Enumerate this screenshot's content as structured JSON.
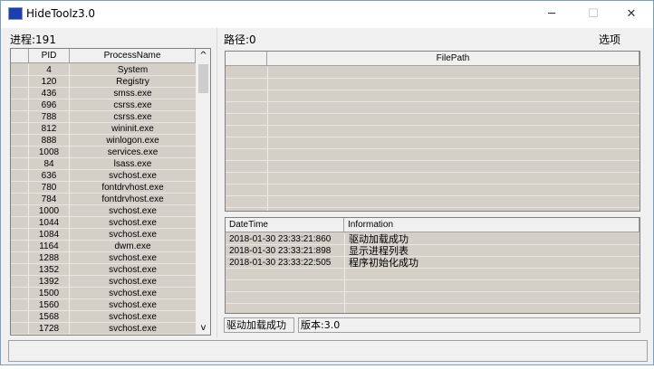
{
  "window": {
    "title": "HideToolz3.0",
    "minimize": "─",
    "maximize": "☐",
    "close": "✕"
  },
  "left": {
    "process_count_label": "进程:191",
    "columns": [
      "",
      "PID",
      "ProcessName"
    ],
    "processes": [
      {
        "pid": "4",
        "name": "System"
      },
      {
        "pid": "120",
        "name": "Registry"
      },
      {
        "pid": "436",
        "name": "smss.exe"
      },
      {
        "pid": "696",
        "name": "csrss.exe"
      },
      {
        "pid": "788",
        "name": "csrss.exe"
      },
      {
        "pid": "812",
        "name": "wininit.exe"
      },
      {
        "pid": "888",
        "name": "winlogon.exe"
      },
      {
        "pid": "1008",
        "name": "services.exe"
      },
      {
        "pid": "84",
        "name": "lsass.exe"
      },
      {
        "pid": "636",
        "name": "svchost.exe"
      },
      {
        "pid": "780",
        "name": "fontdrvhost.exe"
      },
      {
        "pid": "784",
        "name": "fontdrvhost.exe"
      },
      {
        "pid": "1000",
        "name": "svchost.exe"
      },
      {
        "pid": "1044",
        "name": "svchost.exe"
      },
      {
        "pid": "1084",
        "name": "svchost.exe"
      },
      {
        "pid": "1164",
        "name": "dwm.exe"
      },
      {
        "pid": "1288",
        "name": "svchost.exe"
      },
      {
        "pid": "1352",
        "name": "svchost.exe"
      },
      {
        "pid": "1392",
        "name": "svchost.exe"
      },
      {
        "pid": "1500",
        "name": "svchost.exe"
      },
      {
        "pid": "1560",
        "name": "svchost.exe"
      },
      {
        "pid": "1568",
        "name": "svchost.exe"
      },
      {
        "pid": "1728",
        "name": "svchost.exe"
      }
    ],
    "scroll_up": "^",
    "scroll_down": "v"
  },
  "right": {
    "path_label": "路径:0",
    "options_label": "选项",
    "filepath_header": "FilePath",
    "log_columns": [
      "DateTime",
      "Information"
    ],
    "log": [
      {
        "time": "2018-01-30 23:33:21:860",
        "info": "驱动加载成功"
      },
      {
        "time": "2018-01-30 23:33:21:898",
        "info": "显示进程列表"
      },
      {
        "time": "2018-01-30 23:33:22:505",
        "info": "程序初始化成功"
      }
    ],
    "status_left": "驱动加载成功",
    "status_right": "版本:3.0"
  }
}
